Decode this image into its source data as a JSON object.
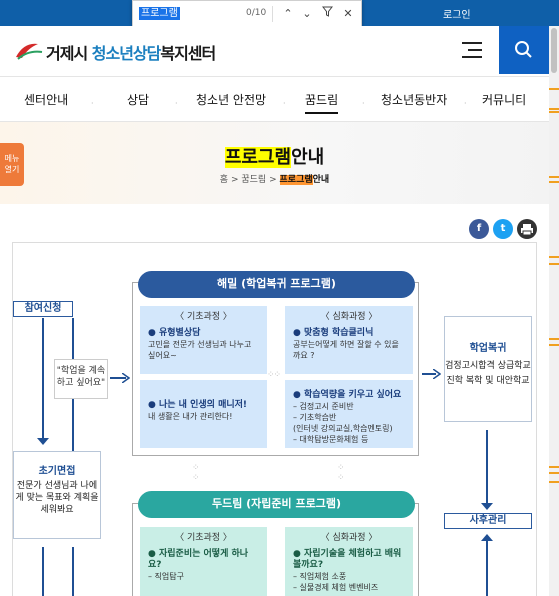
{
  "browser": {
    "find_query": "프로그램",
    "find_count": "0/10"
  },
  "topbar": {
    "login": "로그인"
  },
  "logo": {
    "part1": "거제시",
    "part2": "청소년상담",
    "part3": "복지센터"
  },
  "gnb": [
    "센터안내",
    "상담",
    "청소년 안전망",
    "꿈드림",
    "청소년동반자",
    "커뮤니티"
  ],
  "hero": {
    "menu_open": "메뉴 열기",
    "title_hl": "프로그램",
    "title_rest": "안내",
    "crumb": {
      "home": "홈",
      "sep": ">",
      "c1": "꿈드림",
      "c2_hl": "프로그램",
      "c2_rest": "안내"
    }
  },
  "share": [
    "f",
    "t",
    "p"
  ],
  "chart": {
    "left_head": "참여신청",
    "quote": "\"학업을 계속 하고 싶어요\"",
    "interview_title": "초기면접",
    "interview_desc": "전문가 선생님과 나에게 맞는 목표와 계획을 세워봐요",
    "top_pill": "해밀 (학업복귀 프로그램)",
    "bot_pill": "두드림 (자립준비 프로그램)",
    "c1": {
      "cat": "〈 기초과정 〉",
      "h1": "● 유형별상담",
      "d1": "고민을 전문가 선생님과 나누고 싶어요~",
      "h2": "● 나는 내 인생의 매니저!",
      "d2": "내 생활은 내가 관리한다!"
    },
    "c2": {
      "cat": "〈 심화과정 〉",
      "h1": "● 맞춤형 학습클리닉",
      "d1": "공부는어떻게 하면 잘할 수 있을까요 ?",
      "h2": "● 학습역량을 키우고 싶어요",
      "d2a": "– 검정고시 준비반",
      "d2b": "– 기초학습반",
      "d2c": "(인터넷 강의교실,학습멘토링)",
      "d2d": "– 대학탐방문화체험 등"
    },
    "c3": {
      "cat": "〈 기초과정 〉",
      "h1": "● 자립준비는 어떻게 하나요?",
      "d1": "– 직업탐구"
    },
    "c4": {
      "cat": "〈 심화과정 〉",
      "h1": "● 자립기술을 체험하고 배워 볼까요?",
      "d1": "– 직업체험 소풍",
      "d2": "– 실물경제 체험 벤벤비즈"
    },
    "right_head": "학업복귀",
    "right_desc": "검정고시합격 상급학교 진학 복학 및 대안학교",
    "right_bottom": "사후관리"
  },
  "colors": {
    "brand": "#0f5fa8",
    "accent": "#ee7a3a",
    "pill_top": "#2b5a9e",
    "pill_bottom": "#2aa7a0"
  },
  "icons": {
    "search": "search-icon",
    "menu": "hamburger-icon",
    "facebook": "facebook-icon",
    "twitter": "twitter-icon",
    "print": "print-icon"
  }
}
